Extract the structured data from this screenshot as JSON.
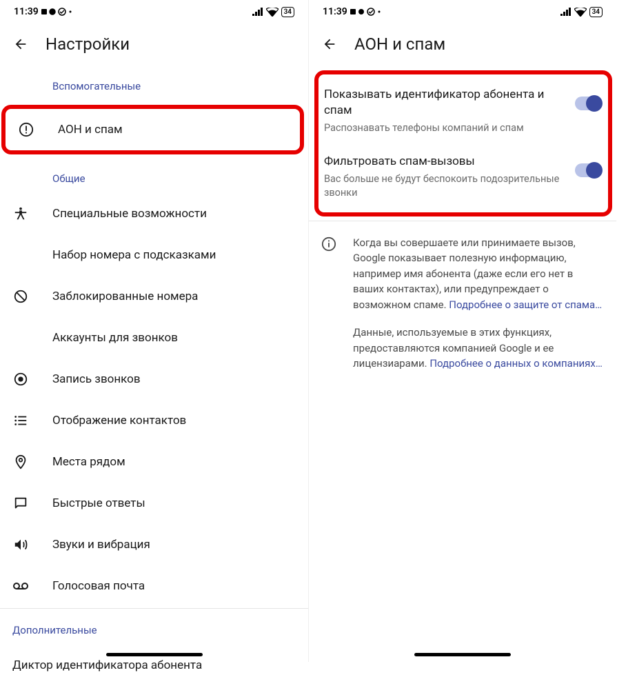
{
  "status": {
    "time": "11:39",
    "icons_left": "✦ 💬 ⊘ ·",
    "signal": "📶",
    "wifi": "📡",
    "battery": "34"
  },
  "left": {
    "title": "Настройки",
    "sections": {
      "aux": "Вспомогательные",
      "general": "Общие",
      "extra": "Дополнительные"
    },
    "items": {
      "caller_id_spam": "АОН и спам",
      "accessibility": "Специальные возможности",
      "assisted_dialing": "Набор номера с подсказками",
      "blocked_numbers": "Заблокированные номера",
      "calling_accounts": "Аккаунты для звонков",
      "call_recording": "Запись звонков",
      "display_options": "Отображение контактов",
      "nearby_places": "Места рядом",
      "quick_responses": "Быстрые ответы",
      "sounds_vibration": "Звуки и вибрация",
      "voicemail": "Голосовая почта",
      "caller_id_announce": "Диктор идентификатора абонента"
    }
  },
  "right": {
    "title": "АОН и спам",
    "toggles": {
      "show_caller_id": {
        "title": "Показывать идентификатор абонента и спам",
        "sub": "Распознавать телефоны компаний и спам"
      },
      "filter_spam": {
        "title": "Фильтровать спам-вызовы",
        "sub": "Вас больше не будут беспокоить подозрительные звонки"
      }
    },
    "info": {
      "p1_a": "Когда вы совершаете или принимаете вызов, Google показывает полезную информацию, например имя абонента (даже если его нет в ваших контактах), или предупреждает о возможном спаме. ",
      "p1_link": "Подробнее о защите от спама…",
      "p2_a": "Данные, используемые в этих функциях, предоставляются компанией Google и ее лицензиарами. ",
      "p2_link": "Подробнее о данных о компаниях…"
    }
  }
}
